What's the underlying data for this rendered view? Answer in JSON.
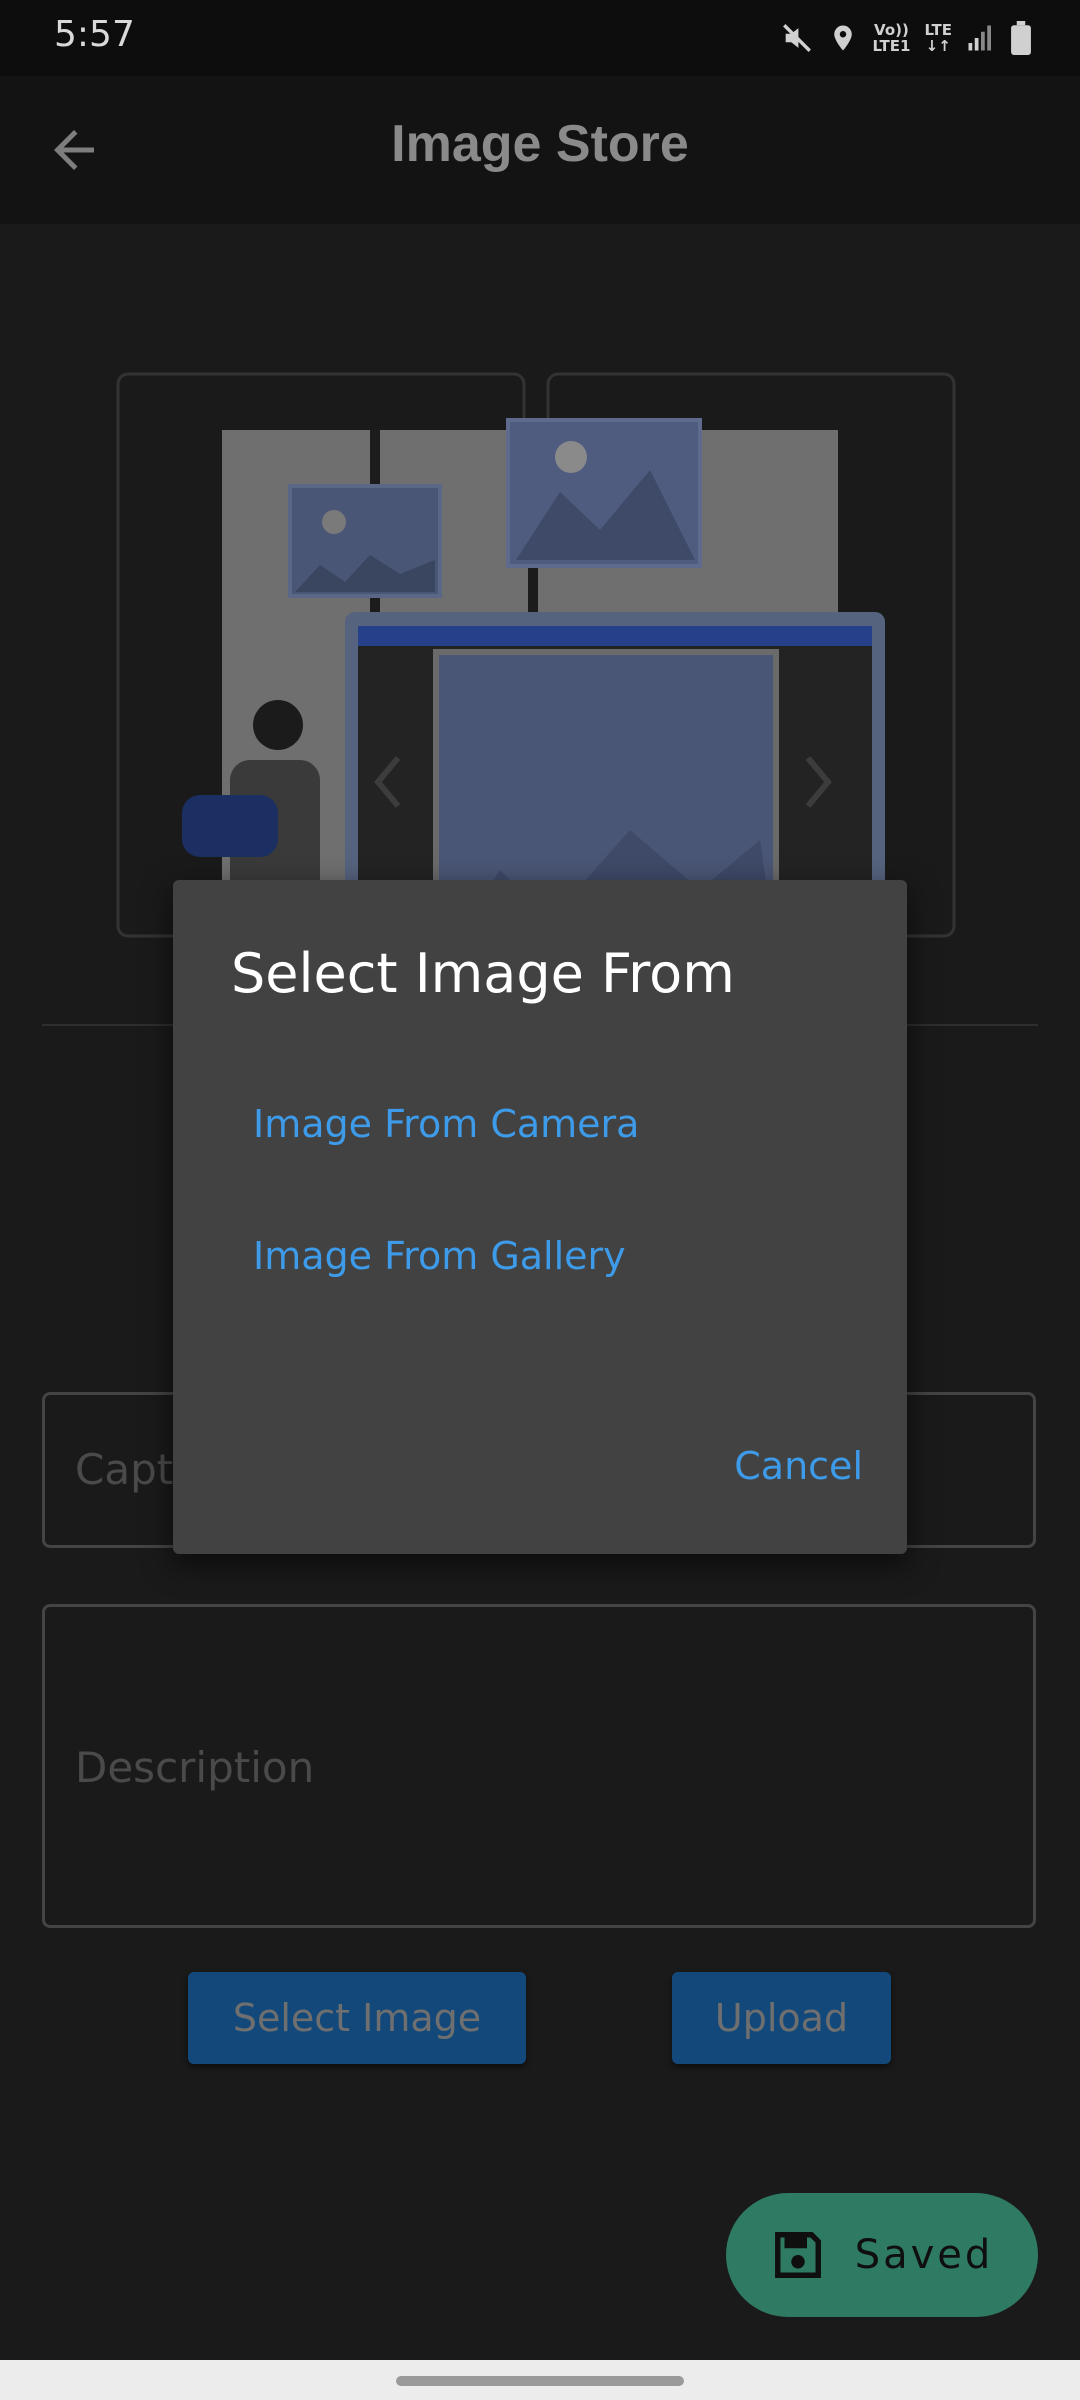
{
  "status_bar": {
    "time": "5:57",
    "lte1_top": "Vo))",
    "lte1_bottom": "LTE1",
    "lte2": "LTE",
    "icons": [
      "mute-icon",
      "location-icon",
      "signal-icon",
      "battery-icon"
    ]
  },
  "app_bar": {
    "title": "Image Store",
    "back_icon": "back-arrow-icon"
  },
  "form": {
    "caption_placeholder": "Capt",
    "description_placeholder": "Description",
    "select_image_label": "Select Image",
    "upload_label": "Upload"
  },
  "fab": {
    "label": "Saved",
    "icon": "save-icon"
  },
  "dialog": {
    "title": "Select Image From",
    "options": [
      "Image From Camera",
      "Image From Gallery"
    ],
    "cancel_label": "Cancel"
  },
  "colors": {
    "background": "#1a1a1a",
    "dialog": "#424242",
    "accent": "#3d9be9",
    "button": "#13497a",
    "fab": "#2f7a63"
  }
}
